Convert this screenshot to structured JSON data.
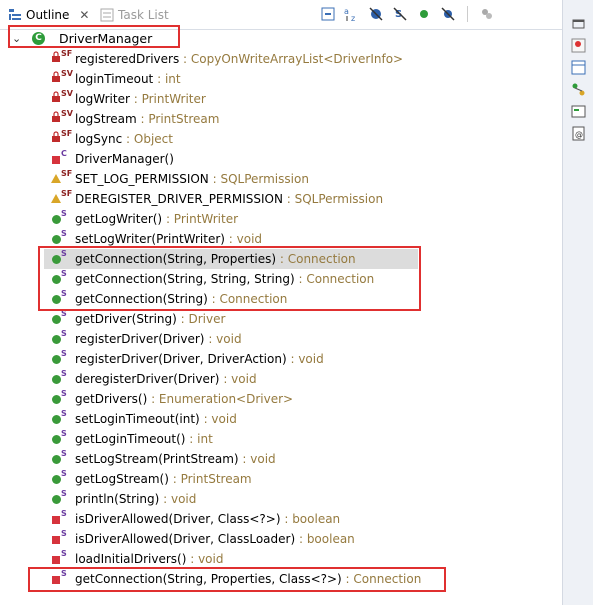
{
  "tabs": [
    {
      "label": "Outline",
      "close": "✕"
    },
    {
      "label": "Task List"
    }
  ],
  "toolbar_icons": [
    "collapse-all-icon",
    "sort-az-icon",
    "hide-fields-icon",
    "hide-static-icon",
    "hide-nonpublic-icon",
    "hide-local-types-icon",
    "view-menu-icon"
  ],
  "root": {
    "name": "DriverManager",
    "icon": "class-icon"
  },
  "members": [
    {
      "name": "registeredDrivers",
      "type": " : CopyOnWriteArrayList<DriverInfo>",
      "vis": "field-private",
      "mod": "SF"
    },
    {
      "name": "loginTimeout",
      "type": " : int",
      "vis": "field-private",
      "mod": "SV"
    },
    {
      "name": "logWriter",
      "type": " : PrintWriter",
      "vis": "field-private",
      "mod": "SV"
    },
    {
      "name": "logStream",
      "type": " : PrintStream",
      "vis": "field-private",
      "mod": "SV"
    },
    {
      "name": "logSync",
      "type": " : Object",
      "vis": "field-private",
      "mod": "SF"
    },
    {
      "name": "DriverManager()",
      "type": "",
      "vis": "method-private",
      "mod": "C"
    },
    {
      "name": "SET_LOG_PERMISSION",
      "type": " : SQLPermission",
      "vis": "field-default",
      "mod": "SF"
    },
    {
      "name": "DEREGISTER_DRIVER_PERMISSION",
      "type": " : SQLPermission",
      "vis": "field-default",
      "mod": "SF"
    },
    {
      "name": "getLogWriter()",
      "type": " : PrintWriter",
      "vis": "method-public",
      "mod": "S"
    },
    {
      "name": "setLogWriter(PrintWriter)",
      "type": " : void",
      "vis": "method-public",
      "mod": "S"
    },
    {
      "name": "getConnection(String, Properties)",
      "type": " : Connection",
      "vis": "method-public",
      "mod": "S"
    },
    {
      "name": "getConnection(String, String, String)",
      "type": " : Connection",
      "vis": "method-public",
      "mod": "S"
    },
    {
      "name": "getConnection(String)",
      "type": " : Connection",
      "vis": "method-public",
      "mod": "S"
    },
    {
      "name": "getDriver(String)",
      "type": " : Driver",
      "vis": "method-public",
      "mod": "S"
    },
    {
      "name": "registerDriver(Driver)",
      "type": " : void",
      "vis": "method-public",
      "mod": "S"
    },
    {
      "name": "registerDriver(Driver, DriverAction)",
      "type": " : void",
      "vis": "method-public",
      "mod": "S"
    },
    {
      "name": "deregisterDriver(Driver)",
      "type": " : void",
      "vis": "method-public",
      "mod": "S"
    },
    {
      "name": "getDrivers()",
      "type": " : Enumeration<Driver>",
      "vis": "method-public",
      "mod": "S"
    },
    {
      "name": "setLoginTimeout(int)",
      "type": " : void",
      "vis": "method-public",
      "mod": "S"
    },
    {
      "name": "getLoginTimeout()",
      "type": " : int",
      "vis": "method-public",
      "mod": "S"
    },
    {
      "name": "setLogStream(PrintStream)",
      "type": " : void",
      "vis": "method-public",
      "mod": "S"
    },
    {
      "name": "getLogStream()",
      "type": " : PrintStream",
      "vis": "method-public",
      "mod": "S"
    },
    {
      "name": "println(String)",
      "type": " : void",
      "vis": "method-public",
      "mod": "S"
    },
    {
      "name": "isDriverAllowed(Driver, Class<?>)",
      "type": " : boolean",
      "vis": "method-private",
      "mod": "S"
    },
    {
      "name": "isDriverAllowed(Driver, ClassLoader)",
      "type": " : boolean",
      "vis": "method-private",
      "mod": "S"
    },
    {
      "name": "loadInitialDrivers()",
      "type": " : void",
      "vis": "method-private",
      "mod": "S"
    },
    {
      "name": "getConnection(String, Properties, Class<?>)",
      "type": " : Connection",
      "vis": "method-private",
      "mod": "S"
    }
  ],
  "selected_index": 10,
  "right_toolbar_icons": [
    "minimize-icon",
    "problems-icon",
    "outline-view-icon",
    "hierarchy-icon",
    "console-icon",
    "javadoc-icon"
  ]
}
